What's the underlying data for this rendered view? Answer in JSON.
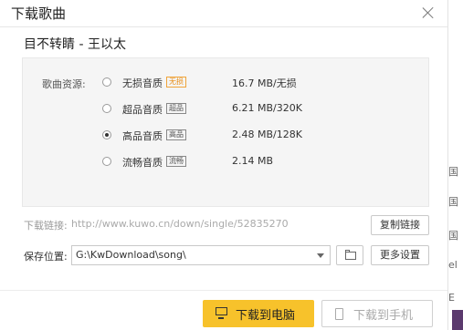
{
  "dialog": {
    "title": "下载歌曲",
    "song_title": "目不转睛 - 王以太",
    "source_label": "歌曲资源:",
    "qualities": [
      {
        "name": "无损音质",
        "badge": "无损",
        "size": "16.7 MB/无损",
        "selected": false
      },
      {
        "name": "超品音质",
        "badge": "超品",
        "size": "6.21 MB/320K",
        "selected": false
      },
      {
        "name": "高品音质",
        "badge": "高品",
        "size": "2.48 MB/128K",
        "selected": true
      },
      {
        "name": "流畅音质",
        "badge": "流畅",
        "size": "2.14 MB",
        "selected": false
      }
    ],
    "link_label": "下载链接:",
    "link_url": "http://www.kuwo.cn/down/single/52835270",
    "copy_button": "复制链接",
    "save_label": "保存位置:",
    "save_path": "G:\\KwDownload\\song\\",
    "more_settings": "更多设置",
    "download_pc": "下载到电脑",
    "download_phone": "下载到手机"
  },
  "background_strip": [
    "国",
    "国",
    "国",
    "el",
    "E"
  ],
  "colors": {
    "primary_button": "#f7c22b",
    "lossless_badge": "#e8901c"
  }
}
